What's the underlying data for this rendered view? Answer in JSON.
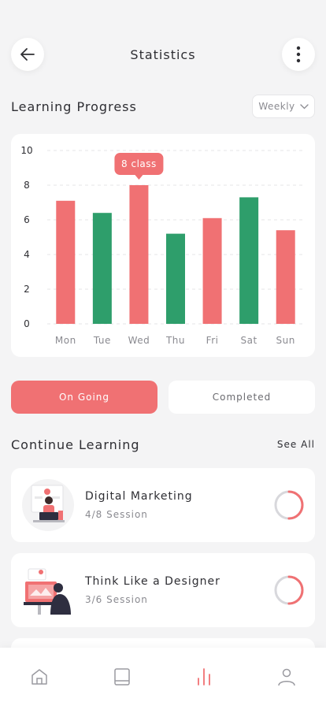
{
  "header": {
    "title": "Statistics",
    "back_icon": "arrow-left-icon",
    "more_icon": "more-vertical-icon"
  },
  "progress": {
    "title": "Learning Progress",
    "period": "Weekly",
    "tooltip": "8 class",
    "highlight_index": 2
  },
  "chart_data": {
    "type": "bar",
    "categories": [
      "Mon",
      "Tue",
      "Wed",
      "Thu",
      "Fri",
      "Sat",
      "Sun"
    ],
    "values": [
      7.1,
      6.4,
      8.0,
      5.2,
      6.1,
      7.3,
      5.4
    ],
    "bar_colors": [
      "#f07173",
      "#2e9e6b",
      "#f07173",
      "#2e9e6b",
      "#f07173",
      "#2e9e6b",
      "#f07173"
    ],
    "yticks": [
      "0",
      "2",
      "4",
      "6",
      "8",
      "10"
    ],
    "ylim": [
      0,
      10
    ],
    "grid": true,
    "title": "",
    "xlabel": "",
    "ylabel": ""
  },
  "tabs": [
    {
      "label": "On Going",
      "active": true
    },
    {
      "label": "Completed",
      "active": false
    }
  ],
  "continue": {
    "title": "Continue Learning",
    "see_all": "See All",
    "courses": [
      {
        "title": "Digital Marketing",
        "sessions": "4/8 Session",
        "progress": 0.5
      },
      {
        "title": "Think Like a Designer",
        "sessions": "3/6 Session",
        "progress": 0.5
      }
    ]
  },
  "nav": [
    {
      "icon": "home-icon",
      "active": false
    },
    {
      "icon": "book-icon",
      "active": false
    },
    {
      "icon": "stats-icon",
      "active": true
    },
    {
      "icon": "profile-icon",
      "active": false
    }
  ],
  "colors": {
    "accent": "#f07173",
    "green": "#2e9e6b",
    "muted": "#d8d8dc",
    "background": "#f4f4f5"
  }
}
